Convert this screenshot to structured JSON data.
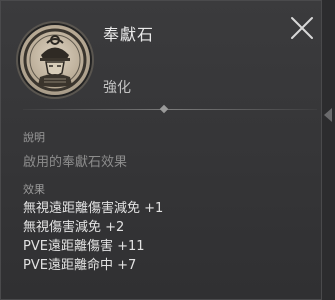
{
  "item": {
    "icon": "samurai-helmet-emblem-icon",
    "name": "奉獻石",
    "type": "強化"
  },
  "close": {
    "icon": "close-icon"
  },
  "description": {
    "label": "說明",
    "text": "啟用的奉獻石效果"
  },
  "effects": {
    "label": "效果",
    "items": [
      "無視遠距離傷害減免 +1",
      "無視傷害減免 +2",
      "PVE遠距離傷害 +11",
      "PVE遠距離命中 +7"
    ]
  }
}
